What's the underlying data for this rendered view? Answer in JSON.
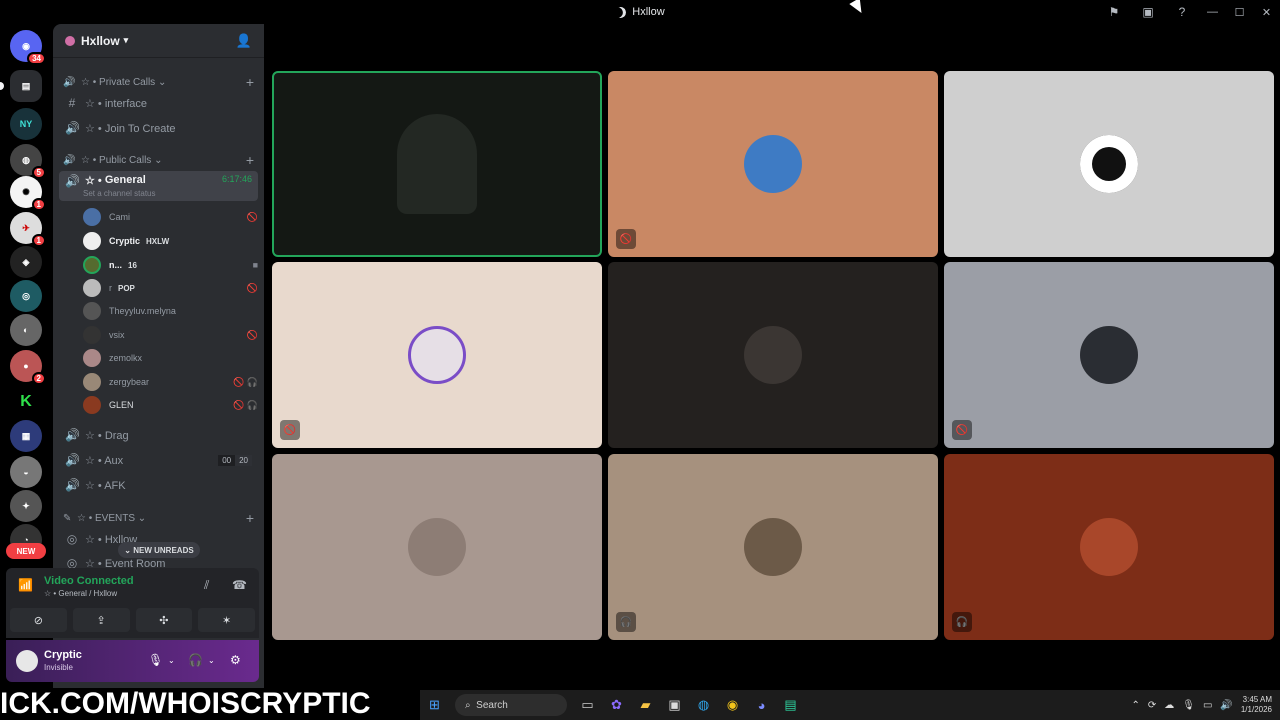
{
  "window": {
    "title": "Hxllow"
  },
  "rail": {
    "badges": [
      "34",
      "5",
      "1",
      "1",
      "2"
    ],
    "new_label": "NEW",
    "server_text": [
      "NY",
      "K"
    ]
  },
  "guild": {
    "name": "Hxllow"
  },
  "categories": {
    "private": "Private Calls",
    "public": "Public Calls",
    "events": "EVENTS"
  },
  "channels": {
    "interface": "☆ • interface",
    "join": "☆ • Join To Create",
    "general": "General",
    "general_prefix": "☆ •",
    "general_time": "6:17:46",
    "general_status": "Set a channel status",
    "drag": "☆ • Drag",
    "aux": "☆ • Aux",
    "aux_counts": [
      "00",
      "20"
    ],
    "afk": "☆ • AFK",
    "hxllow": "☆ • Hxllow",
    "event_room": "☆ • Event Room"
  },
  "users": [
    {
      "name": "Cami",
      "tag": ""
    },
    {
      "name": "Cryptic",
      "tag": "HXLW"
    },
    {
      "name": "n...",
      "tag": "16"
    },
    {
      "name": "r",
      "tag": "POP"
    },
    {
      "name": "Theyyluv.melyna",
      "tag": ""
    },
    {
      "name": "vsix",
      "tag": ""
    },
    {
      "name": "zemolkx",
      "tag": ""
    },
    {
      "name": "zergybear",
      "tag": ""
    },
    {
      "name": "GLEN",
      "tag": ""
    }
  ],
  "new_unreads": "NEW UNREADS",
  "voice": {
    "connected": "Video Connected",
    "location": "☆ • General / Hxllow"
  },
  "me": {
    "name": "Cryptic",
    "status": "Invisible"
  },
  "banner": "ICK.COM/WHOISCRYPTIC",
  "taskbar": {
    "search_placeholder": "Search",
    "time": "3:45 AM",
    "date": "1/1/2026"
  },
  "colors": {
    "accent_green": "#23a55a",
    "red": "#f23f43",
    "sidebar": "#2b2d31"
  }
}
